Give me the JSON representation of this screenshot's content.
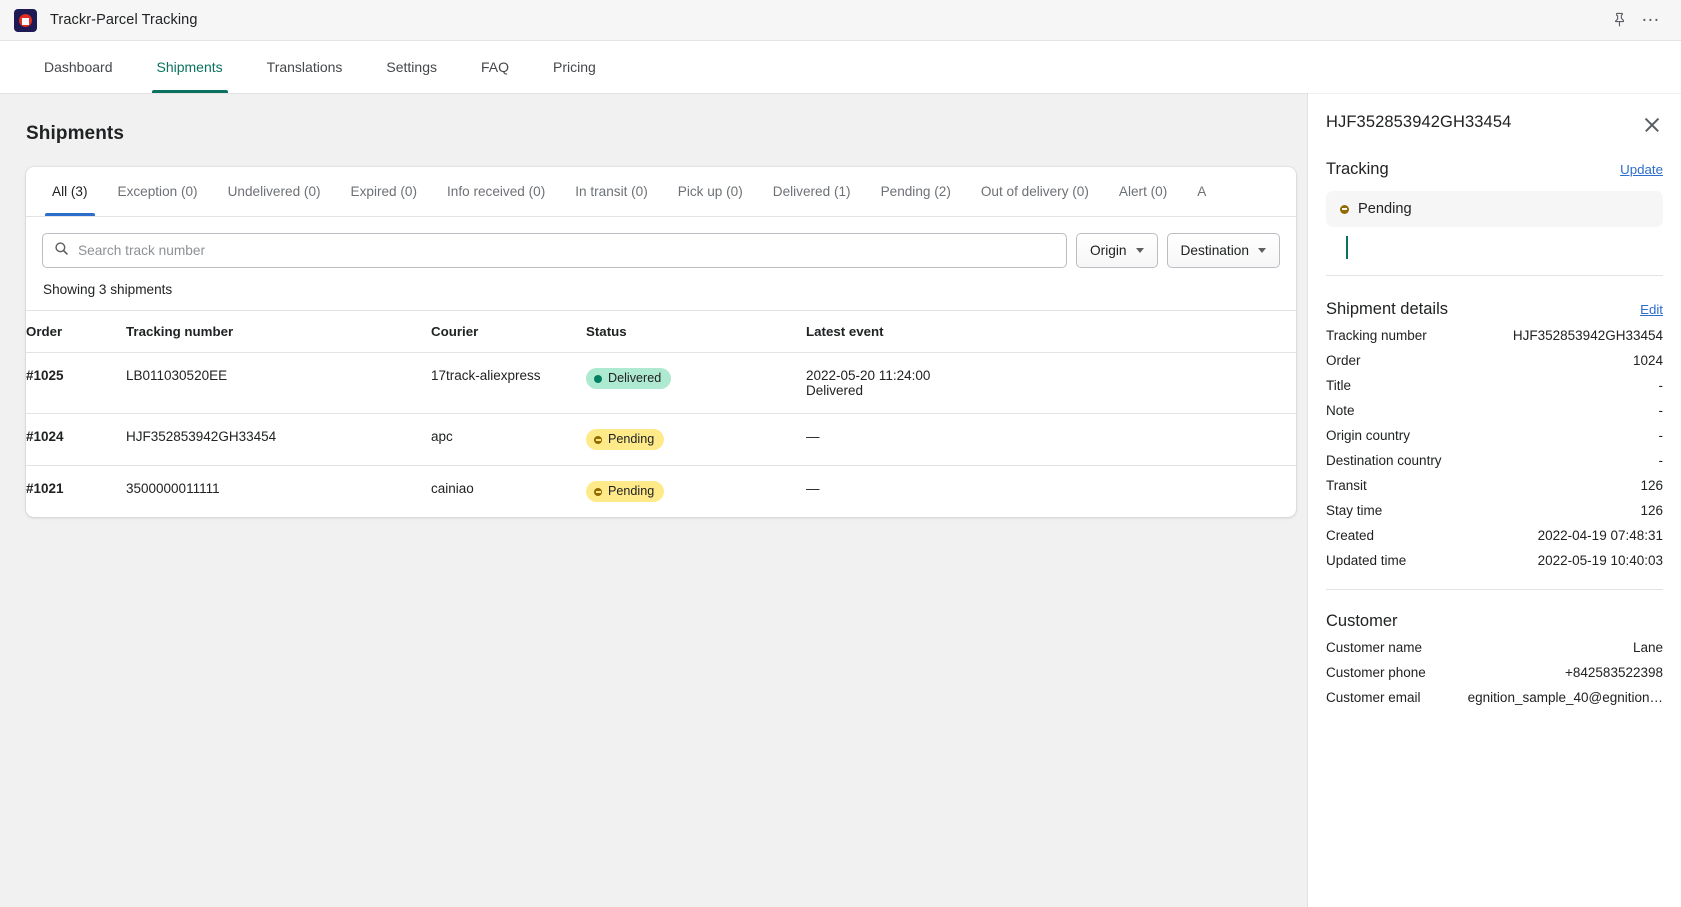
{
  "appbar": {
    "title": "Trackr-Parcel Tracking",
    "logo_icon": "trackr-logo-icon",
    "pin_icon": "pin-icon",
    "more_icon": "more-horizontal-icon"
  },
  "nav": {
    "items": [
      {
        "label": "Dashboard",
        "active": false
      },
      {
        "label": "Shipments",
        "active": true
      },
      {
        "label": "Translations",
        "active": false
      },
      {
        "label": "Settings",
        "active": false
      },
      {
        "label": "FAQ",
        "active": false
      },
      {
        "label": "Pricing",
        "active": false
      }
    ]
  },
  "page": {
    "title": "Shipments"
  },
  "filter_tabs": [
    {
      "label": "All (3)",
      "active": true
    },
    {
      "label": "Exception (0)",
      "active": false
    },
    {
      "label": "Undelivered (0)",
      "active": false
    },
    {
      "label": "Expired (0)",
      "active": false
    },
    {
      "label": "Info received (0)",
      "active": false
    },
    {
      "label": "In transit (0)",
      "active": false
    },
    {
      "label": "Pick up (0)",
      "active": false
    },
    {
      "label": "Delivered (1)",
      "active": false
    },
    {
      "label": "Pending (2)",
      "active": false
    },
    {
      "label": "Out of delivery (0)",
      "active": false
    },
    {
      "label": "Alert (0)",
      "active": false
    },
    {
      "label": "A",
      "active": false
    }
  ],
  "search": {
    "placeholder": "Search track number",
    "value": "",
    "icon": "search-icon"
  },
  "filters": {
    "origin_label": "Origin",
    "destination_label": "Destination"
  },
  "showing_text": "Showing 3 shipments",
  "table": {
    "headers": {
      "order": "Order",
      "tracking": "Tracking number",
      "courier": "Courier",
      "status": "Status",
      "event": "Latest event"
    },
    "rows": [
      {
        "order": "#1025",
        "tracking": "LB011030520EE",
        "courier": "17track-aliexpress",
        "status": "Delivered",
        "status_kind": "delivered",
        "event_line1": "2022-05-20 11:24:00",
        "event_line2": "Delivered"
      },
      {
        "order": "#1024",
        "tracking": "HJF352853942GH33454",
        "courier": "apc",
        "status": "Pending",
        "status_kind": "pending",
        "event_line1": "—",
        "event_line2": ""
      },
      {
        "order": "#1021",
        "tracking": "3500000011111",
        "courier": "cainiao",
        "status": "Pending",
        "status_kind": "pending",
        "event_line1": "—",
        "event_line2": ""
      }
    ]
  },
  "panel": {
    "title": "HJF352853942GH33454",
    "close_icon": "close-icon",
    "tracking": {
      "heading": "Tracking",
      "update_link": "Update",
      "status": "Pending"
    },
    "details": {
      "heading": "Shipment details",
      "edit_link": "Edit",
      "rows": [
        {
          "key": "Tracking number",
          "value": "HJF352853942GH33454"
        },
        {
          "key": "Order",
          "value": "1024"
        },
        {
          "key": "Title",
          "value": "-"
        },
        {
          "key": "Note",
          "value": "-"
        },
        {
          "key": "Origin country",
          "value": "-"
        },
        {
          "key": "Destination country",
          "value": "-"
        },
        {
          "key": "Transit",
          "value": "126"
        },
        {
          "key": "Stay time",
          "value": "126"
        },
        {
          "key": "Created",
          "value": "2022-04-19 07:48:31"
        },
        {
          "key": "Updated time",
          "value": "2022-05-19 10:40:03"
        }
      ]
    },
    "customer": {
      "heading": "Customer",
      "rows": [
        {
          "key": "Customer name",
          "value": "Lane"
        },
        {
          "key": "Customer phone",
          "value": "+842583522398"
        },
        {
          "key": "Customer email",
          "value": "egnition_sample_40@egnition…"
        }
      ]
    }
  },
  "colors": {
    "accent_green": "#0b7260",
    "link_blue": "#2c6ecb",
    "delivered_bg": "#aee9d1",
    "pending_bg": "#ffea8a"
  }
}
